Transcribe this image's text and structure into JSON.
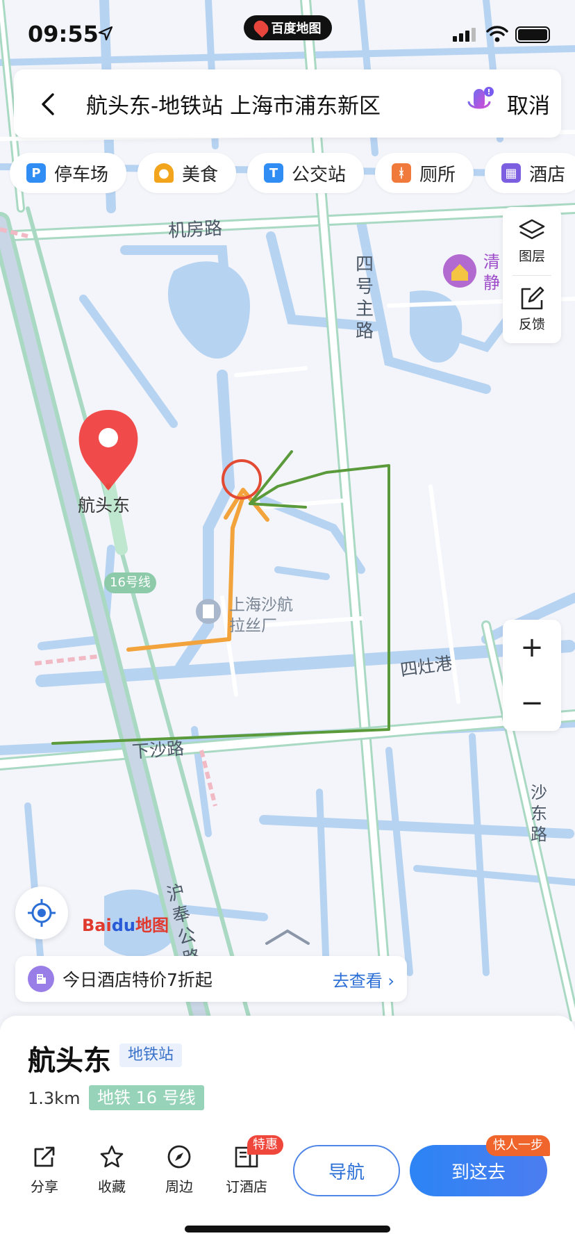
{
  "status_bar": {
    "time": "09:55",
    "badge": "百度地图"
  },
  "search": {
    "query": "航头东-地铁站 上海市浦东新区",
    "cancel": "取消"
  },
  "categories": [
    {
      "label": "停车场",
      "icon": "parking-icon",
      "color": "#2f8df3"
    },
    {
      "label": "美食",
      "icon": "food-icon",
      "color": "#f2a51c"
    },
    {
      "label": "公交站",
      "icon": "bus-stop-icon",
      "color": "#2f8df3"
    },
    {
      "label": "厕所",
      "icon": "toilet-icon",
      "color": "#f07a3b"
    },
    {
      "label": "酒店",
      "icon": "hotel-icon",
      "color": "#7c5ee0"
    }
  ],
  "map_labels": {
    "road_jifang": "机房路",
    "road_sihao": "四号主路",
    "poi_qingjing": "清静",
    "station": "航头东",
    "line16": "16号线",
    "factory": "上海沙航拉丝厂",
    "sizaogang": "四灶港",
    "xiasha": "下沙路",
    "shadong": "沙东路",
    "hufeng": "沪奉公路"
  },
  "tools": {
    "layers": "图层",
    "feedback": "反馈"
  },
  "zoom": {
    "in": "+",
    "out": "−"
  },
  "logo": {
    "text_a": "Bai",
    "text_b": "du",
    "text_c": "地图"
  },
  "promo": {
    "text": "今日酒店特价7折起",
    "link": "去查看 ›"
  },
  "place": {
    "name": "航头东",
    "category": "地铁站",
    "distance": "1.3km",
    "line": "地铁 16 号线"
  },
  "actions": {
    "share": "分享",
    "favorite": "收藏",
    "nearby": "周边",
    "hotel": "订酒店",
    "hotel_badge": "特惠",
    "navigate": "导航",
    "go": "到这去",
    "go_badge": "快人一步"
  },
  "colors": {
    "water": "#b7d3f2",
    "rail": "#a9d9c3",
    "accent": "#2b6fd6",
    "marker": "#e8453c",
    "annotation_orange": "#f3a33c",
    "annotation_green": "#5a9a3a"
  }
}
